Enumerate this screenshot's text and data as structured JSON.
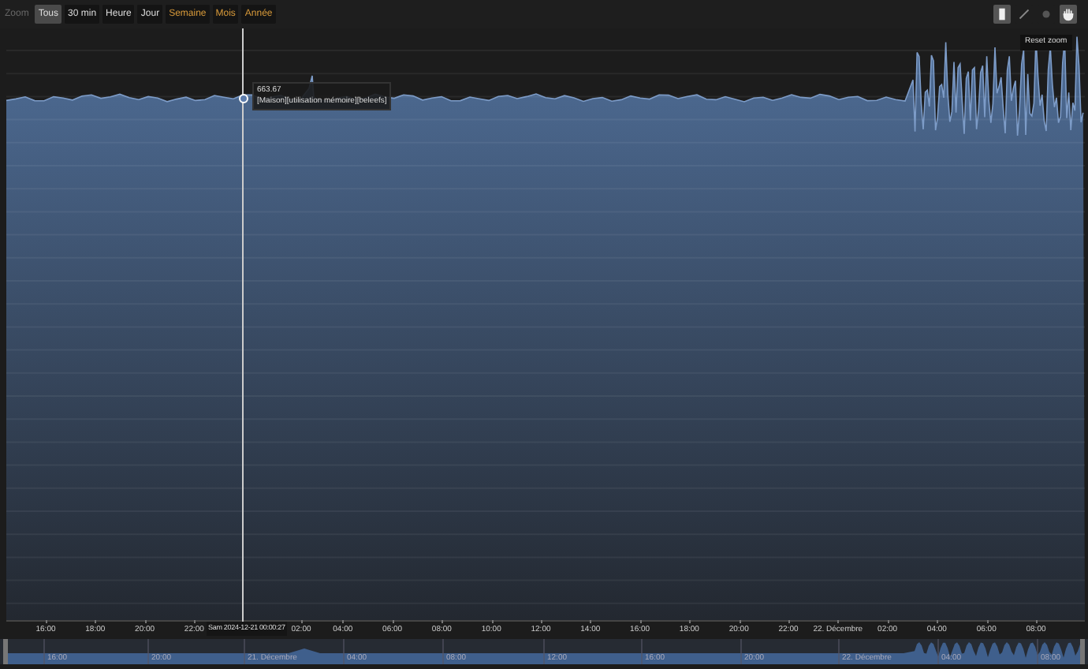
{
  "toolbar": {
    "zoom_label": "Zoom",
    "ranges": [
      {
        "label": "Tous",
        "selected": true,
        "highlighted": false
      },
      {
        "label": "30 min",
        "selected": false,
        "highlighted": false
      },
      {
        "label": "Heure",
        "selected": false,
        "highlighted": false
      },
      {
        "label": "Jour",
        "selected": false,
        "highlighted": false
      },
      {
        "label": "Semaine",
        "selected": false,
        "highlighted": true
      },
      {
        "label": "Mois",
        "selected": false,
        "highlighted": true
      },
      {
        "label": "Année",
        "selected": false,
        "highlighted": true
      }
    ],
    "tools": [
      {
        "kind": "bar",
        "selected": true
      },
      {
        "kind": "pencil",
        "selected": false
      },
      {
        "kind": "circle",
        "selected": false
      },
      {
        "kind": "hand",
        "selected": true
      }
    ]
  },
  "reset_tooltip": "Reset zoom",
  "tooltip": {
    "value": "663.67",
    "series": "[Maison][utilisation mémoire][beleefs]"
  },
  "crosshair_label": "Sam 2024-12-21 00:00:27",
  "x_axis": [
    "16:00",
    "18:00",
    "20:00",
    "22:00",
    "02:00",
    "04:00",
    "06:00",
    "08:00",
    "10:00",
    "12:00",
    "14:00",
    "16:00",
    "18:00",
    "20:00",
    "22:00",
    "22. Décembre",
    "02:00",
    "04:00",
    "06:00",
    "08:00"
  ],
  "navigator_axis": [
    "16:00",
    "20:00",
    "21. Décembre",
    "04:00",
    "08:00",
    "12:00",
    "16:00",
    "20:00",
    "22. Décembre",
    "04:00",
    "08:00"
  ]
}
